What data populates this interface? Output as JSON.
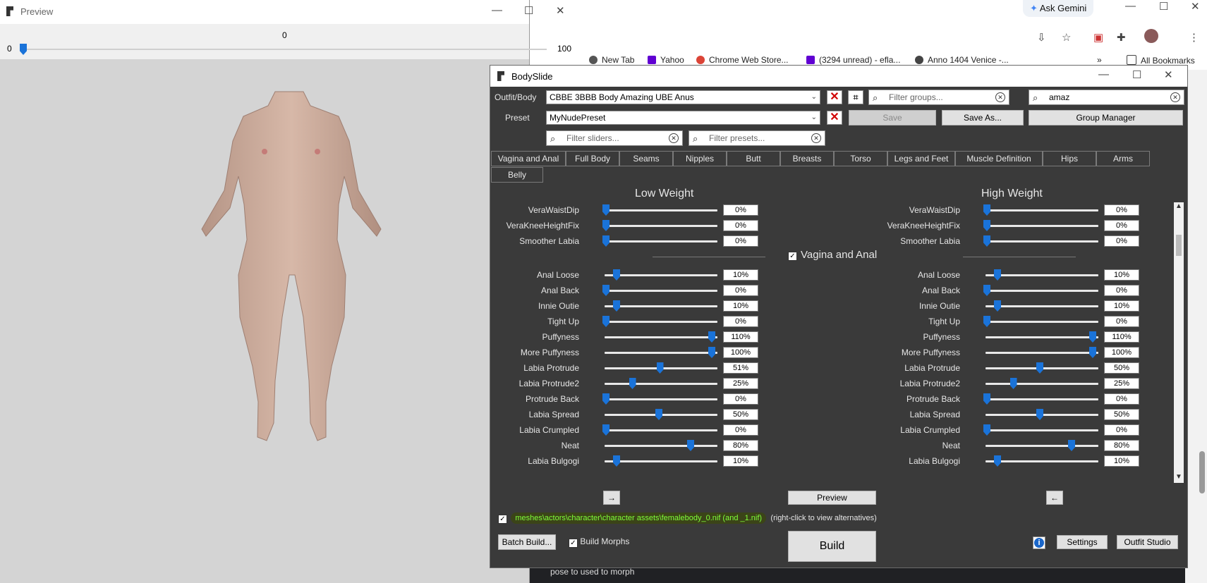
{
  "chrome": {
    "gemini_label": "Ask Gemini",
    "bookmarks": [
      {
        "label": "New Tab",
        "color": "#555555"
      },
      {
        "label": "Yahoo",
        "color": "#6001d2"
      },
      {
        "label": "Chrome Web Store...",
        "color": "#db4437"
      },
      {
        "label": "(3294 unread) - efla...",
        "color": "#6001d2"
      },
      {
        "label": "Anno 1404 Venice -...",
        "color": "#444444"
      }
    ],
    "more_label": "»",
    "all_bookmarks_label": "All Bookmarks",
    "partial_text": "pose to used to morph"
  },
  "preview": {
    "title": "Preview",
    "slider_min": "0",
    "slider_max": "100",
    "slider_value": "0"
  },
  "bodyslide": {
    "title": "BodySlide",
    "outfit_label": "Outfit/Body",
    "outfit_value": "CBBE 3BBB Body Amazing UBE Anus",
    "preset_label": "Preset",
    "preset_value": "MyNudePreset",
    "filter_groups_placeholder": "Filter groups...",
    "filter_outfits_value": "amaz",
    "filter_sliders_placeholder": "Filter sliders...",
    "filter_presets_placeholder": "Filter presets...",
    "save_label": "Save",
    "save_as_label": "Save As...",
    "group_manager_label": "Group Manager",
    "tabs": [
      "Vagina and Anal",
      "Full Body",
      "Seams",
      "Nipples",
      "Butt",
      "Breasts",
      "Torso",
      "Legs and Feet",
      "Muscle Definition",
      "Hips",
      "Arms",
      "Belly"
    ],
    "low_weight_label": "Low Weight",
    "high_weight_label": "High Weight",
    "section_label": "Vagina and Anal",
    "preview_button": "Preview",
    "left_arrow": "→",
    "right_arrow": "←",
    "output_path": "meshes\\actors\\character\\character assets\\femalebody_0.nif (and _1.nif)",
    "output_hint": "(right-click to view alternatives)",
    "batch_build_label": "Batch Build...",
    "build_morphs_label": "Build Morphs",
    "build_label": "Build",
    "settings_label": "Settings",
    "outfit_studio_label": "Outfit Studio"
  },
  "sliders_top": [
    {
      "name": "VeraWaistDip",
      "low": "0%",
      "high": "0%",
      "low_v": 0,
      "high_v": 0
    },
    {
      "name": "VeraKneeHeightFix",
      "low": "0%",
      "high": "0%",
      "low_v": 0,
      "high_v": 0
    },
    {
      "name": "Smoother Labia",
      "low": "0%",
      "high": "0%",
      "low_v": 0,
      "high_v": 0
    }
  ],
  "sliders": [
    {
      "name": "Anal Loose",
      "low": "10%",
      "high": "10%",
      "low_v": 10,
      "high_v": 10
    },
    {
      "name": "Anal Back",
      "low": "0%",
      "high": "0%",
      "low_v": 0,
      "high_v": 0
    },
    {
      "name": "Innie Outie",
      "low": "10%",
      "high": "10%",
      "low_v": 10,
      "high_v": 10
    },
    {
      "name": "Tight Up",
      "low": "0%",
      "high": "0%",
      "low_v": 0,
      "high_v": 0
    },
    {
      "name": "Puffyness",
      "low": "110%",
      "high": "110%",
      "low_v": 100,
      "high_v": 100
    },
    {
      "name": "More Puffyness",
      "low": "100%",
      "high": "100%",
      "low_v": 100,
      "high_v": 100
    },
    {
      "name": "Labia Protrude",
      "low": "51%",
      "high": "50%",
      "low_v": 51,
      "high_v": 50
    },
    {
      "name": "Labia Protrude2",
      "low": "25%",
      "high": "25%",
      "low_v": 25,
      "high_v": 25
    },
    {
      "name": "Protrude Back",
      "low": "0%",
      "high": "0%",
      "low_v": 0,
      "high_v": 0
    },
    {
      "name": "Labia Spread",
      "low": "50%",
      "high": "50%",
      "low_v": 50,
      "high_v": 50
    },
    {
      "name": "Labia Crumpled",
      "low": "0%",
      "high": "0%",
      "low_v": 0,
      "high_v": 0
    },
    {
      "name": "Neat",
      "low": "80%",
      "high": "80%",
      "low_v": 80,
      "high_v": 80
    },
    {
      "name": "Labia Bulgogi",
      "low": "10%",
      "high": "10%",
      "low_v": 10,
      "high_v": 10
    }
  ]
}
